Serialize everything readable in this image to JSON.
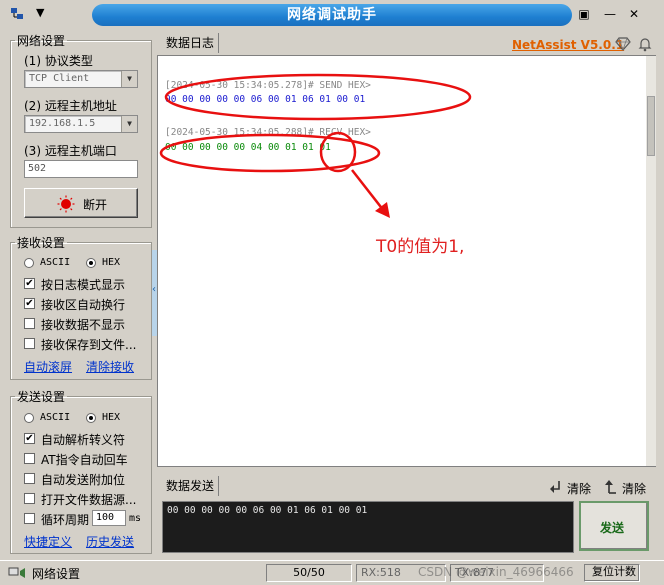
{
  "window": {
    "title": "网络调试助手",
    "brand": "NetAssist V5.0.1",
    "brand_color": "#e06000",
    "title_bar_color": "#1e7fd1",
    "sys_menu_arrow": "▼",
    "pin_glyph": "▣",
    "min_glyph": "—",
    "close_glyph": "✕"
  },
  "net_settings": {
    "group_label": "网络设置",
    "protocol_label": "(1) 协议类型",
    "protocol_value": "TCP Client",
    "host_label": "(2) 远程主机地址",
    "host_value": "192.168.1.5",
    "port_label": "(3) 远程主机端口",
    "port_value": "502",
    "disconnect_label": "断开",
    "combo_arrow": "▼"
  },
  "recv_settings": {
    "group_label": "接收设置",
    "ascii_label": "ASCII",
    "hex_label": "HEX",
    "opts": [
      "按日志模式显示",
      "接收区自动换行",
      "接收数据不显示",
      "接收保存到文件..."
    ],
    "opts_checked": [
      true,
      true,
      false,
      false
    ],
    "auto_scroll": "自动滚屏",
    "clear_recv": "清除接收"
  },
  "send_settings": {
    "group_label": "发送设置",
    "ascii_label": "ASCII",
    "hex_label": "HEX",
    "opts": [
      "自动解析转义符",
      "AT指令自动回车",
      "自动发送附加位",
      "打开文件数据源...",
      "循环周期"
    ],
    "opts_checked": [
      true,
      false,
      false,
      false,
      false
    ],
    "cycle_value": "100",
    "cycle_unit": "ms",
    "shortcut": "快捷定义",
    "history": "历史发送"
  },
  "log": {
    "tab_label": "数据日志",
    "lines": [
      {
        "header": "[2024-05-30 15:34:05.278]# SEND HEX>",
        "data": "00 00 00 00 00 06 00 01 06 01 00 01",
        "color": "#1a1ad0"
      },
      {
        "header": "[2024-05-30 15:34:05.288]# RECV HEX>",
        "data": "00 00 00 00 00 04 00 01 01 01",
        "color": "#0a8a0a"
      }
    ],
    "annotation": "T0的值为1,",
    "annotation_color": "#e02020"
  },
  "send": {
    "tab_label": "数据发送",
    "clear1": "清除",
    "clear2": "清除",
    "content": "00 00 00 00 00 06 00 01 06 01 00 01",
    "send_button": "发送"
  },
  "status": {
    "label": "网络设置",
    "counter": "50/50",
    "rx": "RX:518",
    "tx": "TX:877",
    "reset": "复位计数",
    "watermark": "CSDN @weixin_46966466"
  }
}
